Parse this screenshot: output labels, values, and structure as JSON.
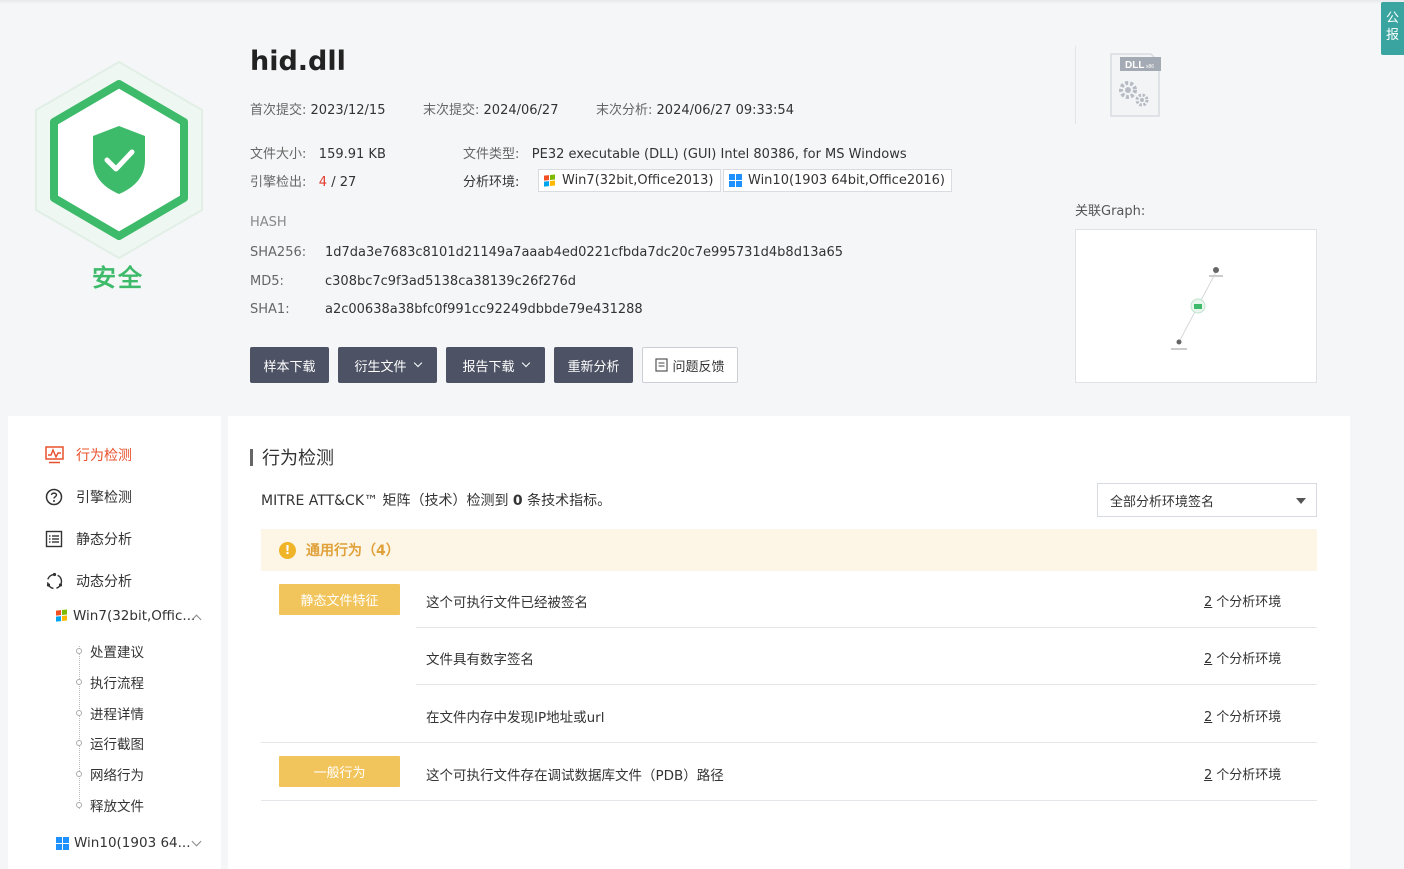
{
  "file": {
    "name": "hid.dll",
    "verdict": "安全",
    "first_submit_label": "首次提交:",
    "first_submit": "2023/12/15",
    "last_submit_label": "末次提交:",
    "last_submit": "2024/06/27",
    "last_analysis_label": "末次分析:",
    "last_analysis": "2024/06/27 09:33:54",
    "size_label": "文件大小:",
    "size": "159.91 KB",
    "type_label": "文件类型:",
    "type": "PE32 executable (DLL) (GUI) Intel 80386, for MS Windows",
    "engine_label": "引擎检出:",
    "engine_detected": "4",
    "engine_total": "/ 27",
    "env_label": "分析环境:",
    "envs": [
      "Win7(32bit,Office2013)",
      "Win10(1903 64bit,Office2016)"
    ],
    "hash_title": "HASH",
    "sha256_label": "SHA256:",
    "sha256": "1d7da3e7683c8101d21149a7aaab4ed0221cfbda7dc20c7e995731d4b8d13a65",
    "md5_label": "MD5:",
    "md5": "c308bc7c9f3ad5138ca38139c26f276d",
    "sha1_label": "SHA1:",
    "sha1": "a2c00638a38bfc0f991cc92249dbbde79e431288",
    "dll_icon_text": "DLL",
    "dll_icon_sub": "x86"
  },
  "actions": {
    "download_sample": "样本下载",
    "derived_files": "衍生文件",
    "download_report": "报告下载",
    "reanalyze": "重新分析",
    "feedback": "问题反馈"
  },
  "graph": {
    "label": "关联Graph:"
  },
  "side_tab": {
    "line1": "公",
    "line2": "报"
  },
  "sidebar": {
    "items": [
      "行为检测",
      "引擎检测",
      "静态分析",
      "动态分析"
    ],
    "env1": "Win7(32bit,Offic...",
    "sub_items": [
      "处置建议",
      "执行流程",
      "进程详情",
      "运行截图",
      "网络行为",
      "释放文件"
    ],
    "env2": "Win10(1903 64..."
  },
  "main": {
    "title": "行为检测",
    "mitre_prefix": "MITRE ATT&CK™ 矩阵（技术）检测到 ",
    "mitre_count": "0",
    "mitre_suffix": " 条技术指标。",
    "select_value": "全部分析环境签名",
    "group_title": "通用行为（4）",
    "categories": [
      "静态文件特征",
      "一般行为"
    ],
    "behaviors": [
      {
        "text": "这个可执行文件已经被签名",
        "count": "2",
        "suffix": "个分析环境"
      },
      {
        "text": "文件具有数字签名",
        "count": "2",
        "suffix": "个分析环境"
      },
      {
        "text": "在文件内存中发现IP地址或url",
        "count": "2",
        "suffix": "个分析环境"
      },
      {
        "text": "这个可执行文件存在调试数据库文件（PDB）路径",
        "count": "2",
        "suffix": "个分析环境"
      }
    ]
  },
  "colors": {
    "safe_green": "#3dbb6a",
    "accent_orange": "#e8502c",
    "tag_yellow": "#f2c55c",
    "button_dark": "#4d5364"
  }
}
